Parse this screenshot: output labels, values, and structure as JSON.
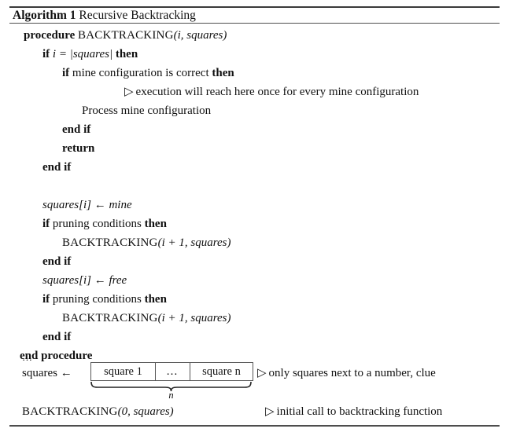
{
  "caption": {
    "number": "Algorithm 1",
    "title": "Recursive Backtracking"
  },
  "comment_marker": "▷",
  "lines": {
    "procedure_head": {
      "kw": "procedure",
      "name": "BACKTRACKING",
      "args": "(i, squares)"
    },
    "if_i_eq": {
      "kw1": "if",
      "cond": "i = |squares|",
      "kw2": "then"
    },
    "if_mine_correct": {
      "kw1": "if",
      "cond": "mine configuration is correct",
      "kw2": "then"
    },
    "comment_execution": "execution will reach here once for every mine configuration",
    "process_mine": "Process mine configuration",
    "end_if_1": "end if",
    "return": "return",
    "end_if_2": "end if",
    "assign_mine": "squares[i] ← mine",
    "if_pruning_1": {
      "kw1": "if",
      "cond": "pruning conditions",
      "kw2": "then"
    },
    "call_1": {
      "name": "BACKTRACKING",
      "args": "(i + 1, squares)"
    },
    "end_if_3": "end if",
    "assign_free": "squares[i] ← free",
    "if_pruning_2": {
      "kw1": "if",
      "cond": "pruning conditions",
      "kw2": "then"
    },
    "call_2": {
      "name": "BACKTRACKING",
      "args": "(i + 1, squares)"
    },
    "end_if_4": "end if",
    "end_procedure": "end procedure",
    "ellipsis": "…",
    "squares_assign_label": "squares ←",
    "comment_only_squares": "only squares next to a number, clue",
    "initial_call": {
      "name": "BACKTRACKING",
      "args": "(0, squares)"
    },
    "comment_initial_call": "initial call to backtracking function"
  },
  "array_box": {
    "cells": [
      "square 1",
      "…",
      "square n"
    ],
    "brace_label": "n"
  },
  "colors": {
    "text": "#111111",
    "rule": "#4d4d4d",
    "box_border": "#555555",
    "background": "#ffffff"
  }
}
